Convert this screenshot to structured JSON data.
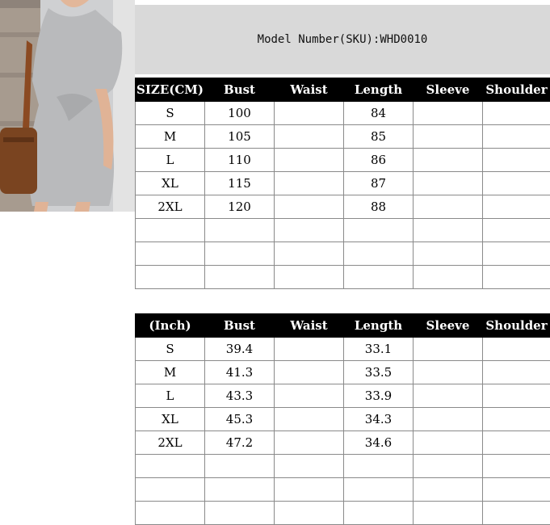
{
  "model_number": "Model Number(SKU):WHD0010",
  "photo": {
    "alt": "dress-photo"
  },
  "cm_table": {
    "headers": [
      "SIZE(CM)",
      "Bust",
      "Waist",
      "Length",
      "Sleeve",
      "Shoulder"
    ],
    "rows": [
      [
        "S",
        "100",
        "",
        "84",
        "",
        ""
      ],
      [
        "M",
        "105",
        "",
        "85",
        "",
        ""
      ],
      [
        "L",
        "110",
        "",
        "86",
        "",
        ""
      ],
      [
        "XL",
        "115",
        "",
        "87",
        "",
        ""
      ],
      [
        "2XL",
        "120",
        "",
        "88",
        "",
        ""
      ],
      [
        "",
        "",
        "",
        "",
        "",
        ""
      ],
      [
        "",
        "",
        "",
        "",
        "",
        ""
      ],
      [
        "",
        "",
        "",
        "",
        "",
        ""
      ]
    ]
  },
  "inch_table": {
    "headers": [
      "(Inch)",
      "Bust",
      "Waist",
      "Length",
      "Sleeve",
      "Shoulder"
    ],
    "rows": [
      [
        "S",
        "39.4",
        "",
        "33.1",
        "",
        ""
      ],
      [
        "M",
        "41.3",
        "",
        "33.5",
        "",
        ""
      ],
      [
        "L",
        "43.3",
        "",
        "33.9",
        "",
        ""
      ],
      [
        "XL",
        "45.3",
        "",
        "34.3",
        "",
        ""
      ],
      [
        "2XL",
        "47.2",
        "",
        "34.6",
        "",
        ""
      ],
      [
        "",
        "",
        "",
        "",
        "",
        ""
      ],
      [
        "",
        "",
        "",
        "",
        "",
        ""
      ],
      [
        "",
        "",
        "",
        "",
        "",
        ""
      ]
    ]
  }
}
